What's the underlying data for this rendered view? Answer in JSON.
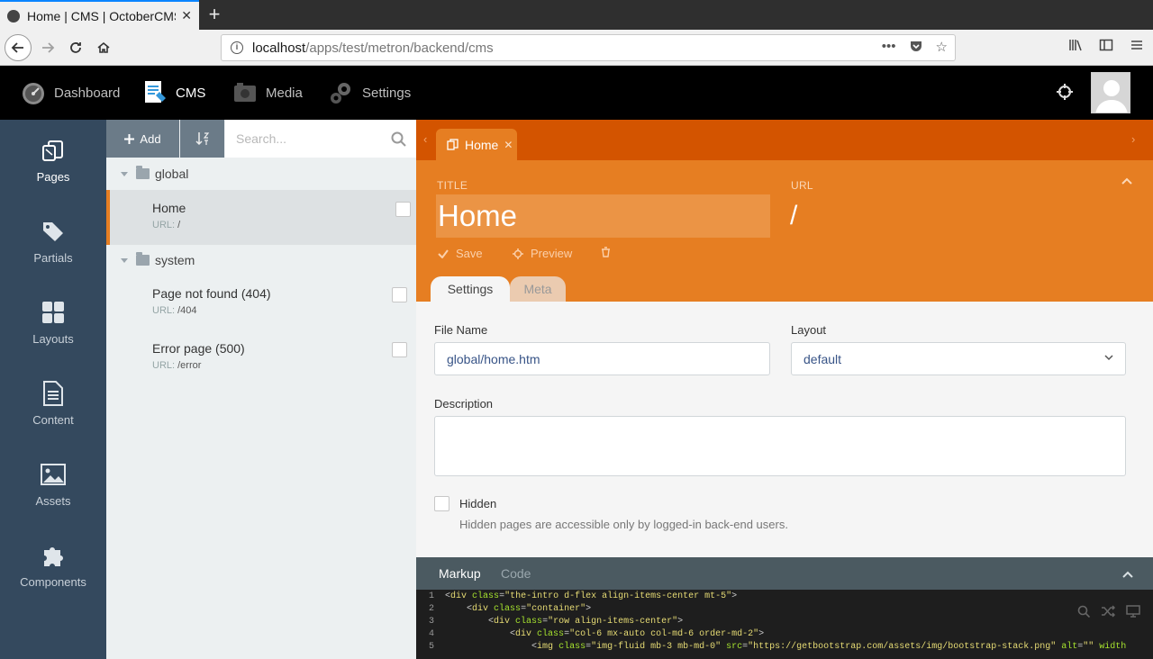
{
  "browser": {
    "tab_title": "Home | CMS | OctoberCMS",
    "url_host": "localhost",
    "url_path": "/apps/test/metron/backend/cms"
  },
  "topnav": {
    "items": [
      {
        "label": "Dashboard",
        "icon": "dashboard-gauge-icon"
      },
      {
        "label": "CMS",
        "icon": "cms-page-icon"
      },
      {
        "label": "Media",
        "icon": "media-camera-icon"
      },
      {
        "label": "Settings",
        "icon": "settings-gears-icon"
      }
    ],
    "active": "CMS"
  },
  "sidebar": {
    "items": [
      {
        "label": "Pages",
        "icon": "pages-icon"
      },
      {
        "label": "Partials",
        "icon": "tags-icon"
      },
      {
        "label": "Layouts",
        "icon": "grid-icon"
      },
      {
        "label": "Content",
        "icon": "document-icon"
      },
      {
        "label": "Assets",
        "icon": "image-icon"
      },
      {
        "label": "Components",
        "icon": "puzzle-icon"
      }
    ],
    "active": "Pages"
  },
  "list": {
    "add_label": "Add",
    "search_placeholder": "Search...",
    "groups": [
      {
        "name": "global",
        "pages": [
          {
            "name": "Home",
            "url_label": "URL:",
            "url": "/"
          }
        ]
      },
      {
        "name": "system",
        "pages": [
          {
            "name": "Page not found (404)",
            "url_label": "URL:",
            "url": "/404"
          },
          {
            "name": "Error page (500)",
            "url_label": "URL:",
            "url": "/error"
          }
        ]
      }
    ]
  },
  "editor": {
    "tab_label": "Home",
    "title_label": "TITLE",
    "title_value": "Home",
    "url_label": "URL",
    "url_value": "/",
    "save_label": "Save",
    "preview_label": "Preview",
    "subtabs": [
      "Settings",
      "Meta"
    ],
    "form": {
      "file_name_label": "File Name",
      "file_name_value": "global/home.htm",
      "layout_label": "Layout",
      "layout_value": "default",
      "description_label": "Description",
      "hidden_label": "Hidden",
      "hidden_help": "Hidden pages are accessible only by logged-in back-end users."
    },
    "markup_tabs": [
      "Markup",
      "Code"
    ],
    "code_lines": [
      {
        "num": "1",
        "indent": "",
        "tag": "div",
        "attrs": [
          [
            "class",
            "the-intro d-flex align-items-center mt-5"
          ]
        ],
        "tail": ""
      },
      {
        "num": "2",
        "indent": "    ",
        "tag": "div",
        "attrs": [
          [
            "class",
            "container"
          ]
        ],
        "tail": ""
      },
      {
        "num": "3",
        "indent": "        ",
        "tag": "div",
        "attrs": [
          [
            "class",
            "row align-items-center"
          ]
        ],
        "tail": ""
      },
      {
        "num": "4",
        "indent": "            ",
        "tag": "div",
        "attrs": [
          [
            "class",
            "col-6 mx-auto col-md-6 order-md-2"
          ]
        ],
        "tail": ""
      },
      {
        "num": "5",
        "indent": "                ",
        "tag": "img",
        "attrs": [
          [
            "class",
            "img-fluid mb-3 mb-md-0"
          ],
          [
            "src",
            "https://getbootstrap.com/assets/img/bootstrap-stack.png"
          ],
          [
            "alt",
            ""
          ]
        ],
        "tail": " width"
      }
    ]
  },
  "colors": {
    "accent": "#e67e22",
    "accent_dark": "#d35400",
    "sidebar": "#34495e",
    "topbar": "#000000"
  }
}
